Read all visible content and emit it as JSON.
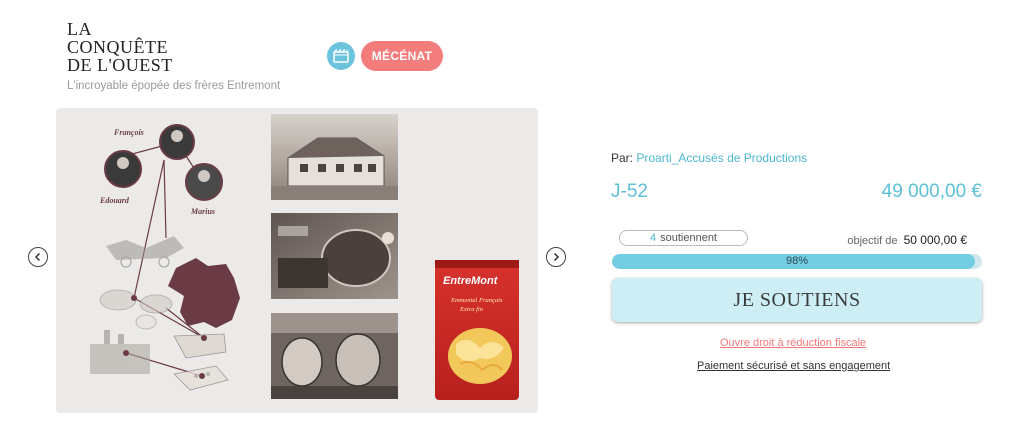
{
  "header": {
    "title_lines": [
      "LA",
      "CONQUÊTE",
      "DE L'OUEST"
    ],
    "subtitle": "L'incroyable épopée des frères Entremont",
    "mecenat_label": "MÉCÉNAT",
    "film_icon": "film-icon"
  },
  "carousel": {
    "prev_icon": "chevron-left-icon",
    "next_icon": "chevron-right-icon",
    "people": [
      "François",
      "Edouard",
      "Marius"
    ],
    "package_brand": "EntreMont",
    "package_text": [
      "Emmental Français",
      "Extra fin"
    ]
  },
  "project": {
    "by_label": "Par:",
    "author": "Proarti_Accusés de Productions",
    "days_left": "J-52",
    "amount": "49 000,00 €",
    "supporters_count": "4",
    "supporters_label": "soutiennent",
    "goal_label": "objectif de",
    "goal_amount": "50 000,00 €",
    "progress_label": "98%",
    "progress_fraction": 0.98,
    "support_button": "JE SOUTIENS",
    "tax_link": "Ouvre droit à réduction fiscale",
    "secure_link": "Paiement sécurisé et sans engagement"
  },
  "colors": {
    "accent": "#5cc0d8",
    "mecenat": "#f37c7c",
    "progress": "#72cde2",
    "map": "#6b3b45"
  }
}
